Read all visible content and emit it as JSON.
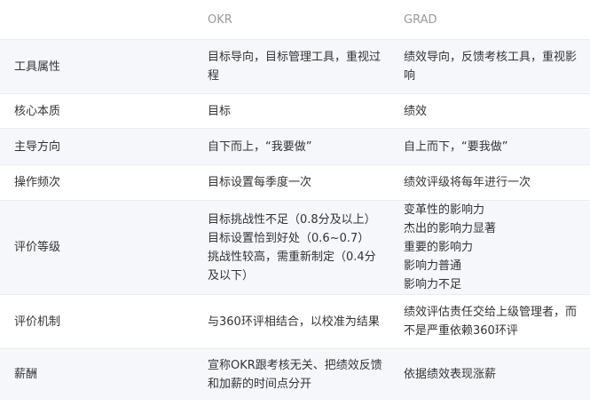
{
  "header": {
    "col0": "",
    "col1": "OKR",
    "col2": "GRAD"
  },
  "rows": [
    {
      "label": "工具属性",
      "okr": [
        "目标导向，目标管理工具，重视过程"
      ],
      "grad": [
        "绩效导向，反馈考核工具，重视影响"
      ]
    },
    {
      "label": "核心本质",
      "okr": [
        "目标"
      ],
      "grad": [
        "绩效"
      ]
    },
    {
      "label": "主导方向",
      "okr": [
        "自下而上，“我要做”"
      ],
      "grad": [
        "自上而下，“要我做”"
      ]
    },
    {
      "label": "操作频次",
      "okr": [
        "目标设置每季度一次"
      ],
      "grad": [
        "绩效评级将每年进行一次"
      ]
    },
    {
      "label": "评价等级",
      "okr": [
        "目标挑战性不足（0.8分及以上）",
        "目标设置恰到好处（0.6~0.7）",
        "挑战性较高，需重新制定（0.4分及以下）"
      ],
      "grad": [
        "变革性的影响力",
        "杰出的影响力显著",
        "重要的影响力",
        "影响力普通",
        "影响力不足"
      ]
    },
    {
      "label": "评价机制",
      "okr": [
        "与360环评相结合，以校准为结果"
      ],
      "grad": [
        "绩效评估责任交给上级管理者，而不是严重依赖360环评"
      ]
    },
    {
      "label": "薪酬",
      "okr": [
        "宣称OKR跟考核无关、把绩效反馈和加薪的时间点分开"
      ],
      "grad": [
        "依据绩效表现涨薪"
      ]
    }
  ],
  "colors": {
    "header_text": "#9a9a9a",
    "body_text": "#333333",
    "stripe_bg": "#f5f7fb",
    "divider": "#e8ebf2"
  }
}
